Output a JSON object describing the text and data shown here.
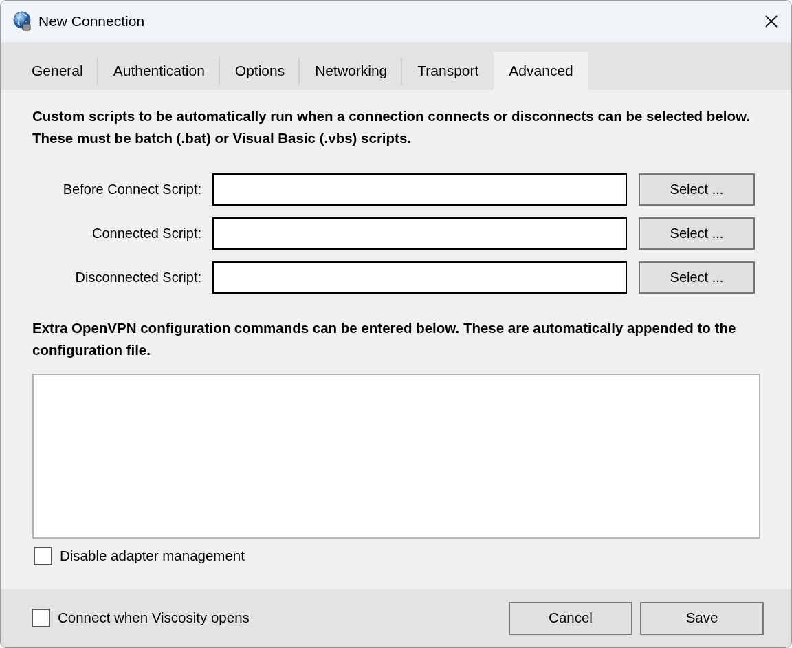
{
  "window": {
    "title": "New Connection"
  },
  "tabs": [
    {
      "label": "General",
      "selected": false
    },
    {
      "label": "Authentication",
      "selected": false
    },
    {
      "label": "Options",
      "selected": false
    },
    {
      "label": "Networking",
      "selected": false
    },
    {
      "label": "Transport",
      "selected": false
    },
    {
      "label": "Advanced",
      "selected": true
    }
  ],
  "scripts_intro": "Custom scripts to be automatically run when a connection connects or disconnects can be selected below. These must be batch (.bat) or Visual Basic (.vbs) scripts.",
  "scripts": [
    {
      "label": "Before Connect Script:",
      "button": "Select ..."
    },
    {
      "label": "Connected Script:",
      "button": "Select ..."
    },
    {
      "label": "Disconnected Script:",
      "button": "Select ..."
    }
  ],
  "extra_intro": "Extra OpenVPN configuration commands can be entered below. These are automatically appended to the configuration file.",
  "disable_adapter": {
    "label": "Disable adapter management",
    "checked": false
  },
  "connect_on_open": {
    "label": "Connect when Viscosity opens",
    "checked": false
  },
  "buttons": [
    "Cancel",
    "Save"
  ]
}
